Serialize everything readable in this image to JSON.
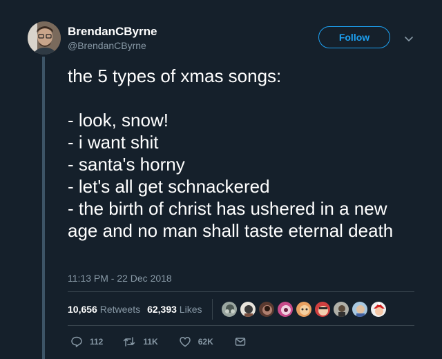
{
  "author": {
    "name": "BrendanCByrne",
    "handle": "@BrendanCByrne"
  },
  "follow_label": "Follow",
  "tweet": {
    "text": "the 5 types of xmas songs:\n\n- look, snow!\n- i want shit\n- santa's horny\n- let's all get schnackered\n- the birth of christ has ushered in a new age and no man shall taste eternal death",
    "timestamp": "11:13 PM - 22 Dec 2018"
  },
  "stats": {
    "retweets": {
      "count": "10,656",
      "label": "Retweets"
    },
    "likes": {
      "count": "62,393",
      "label": "Likes"
    }
  },
  "actions": {
    "reply_count": "112",
    "retweet_count": "11K",
    "like_count": "62K"
  },
  "colors": {
    "background": "#15202b",
    "accent": "#1da1f2",
    "muted": "#8899a6",
    "divider": "#38444d"
  },
  "icons": [
    "reply-icon",
    "retweet-icon",
    "like-icon",
    "message-icon",
    "chevron-down-icon"
  ]
}
